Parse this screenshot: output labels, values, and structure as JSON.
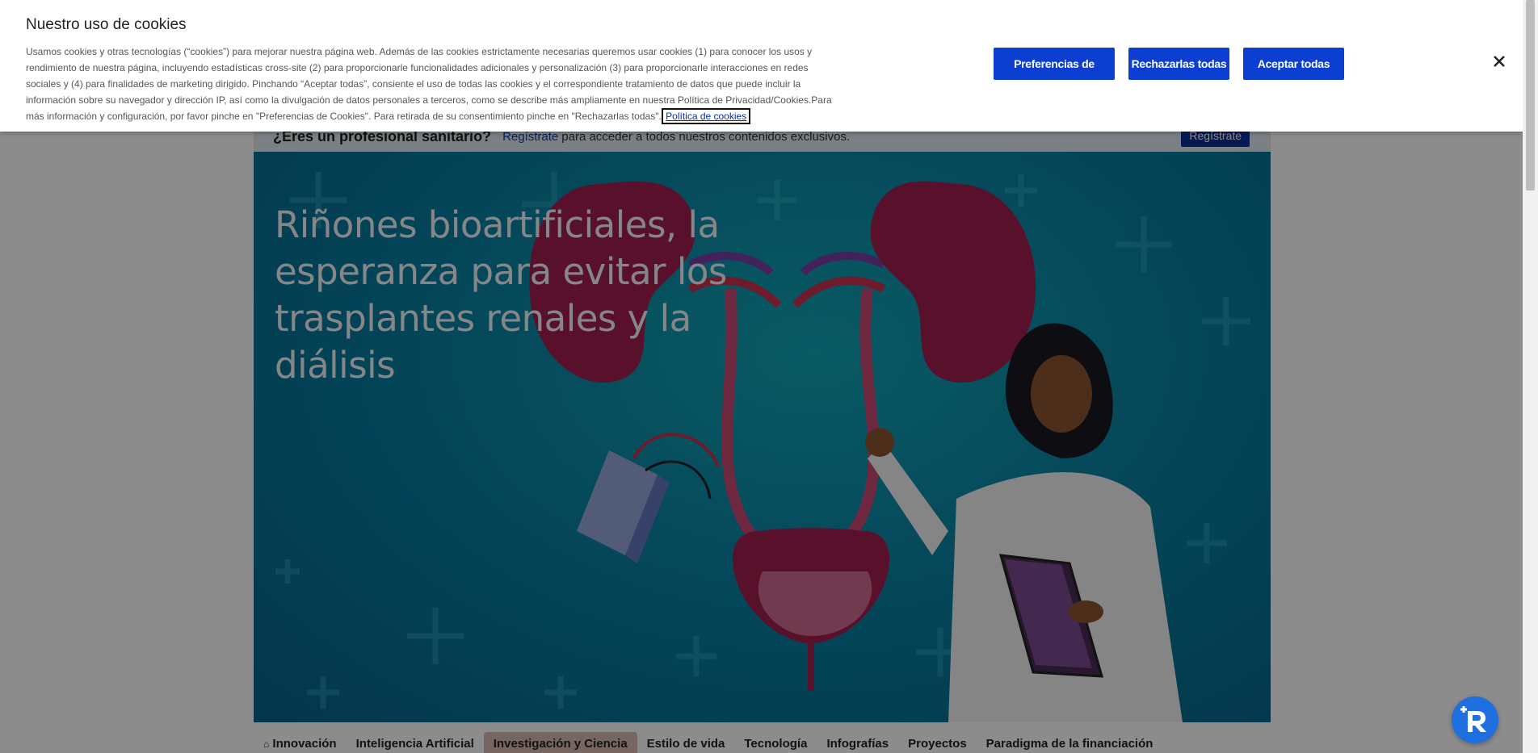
{
  "cookie_banner": {
    "title": "Nuestro uso de cookies",
    "body": "Usamos cookies y otras tecnologías (“cookies”) para mejorar nuestra página web. Además de las cookies estrictamente necesarias queremos usar cookies (1) para conocer los usos y rendimiento de nuestra página, incluyendo estadísticas cross-site (2) para proporcionarle funcionalidades adicionales y personalización (3) para proporcionarle interacciones en redes sociales y (4) para finalidades de marketing dirigido. Pinchando “Aceptar todas”, consiente el uso de todas las cookies y el correspondiente tratamiento de datos que puede incluir la información sobre su navegador y dirección IP, así como la divulgación de datos personales a terceros, como se describe más ampliamente en nuestra Política de Privacidad/Cookies.Para más información y configuración, por favor pinche en \"Preferencias de Cookies\". Para retirada de su consentimiento pinche en \"Rechazarlas todas\".",
    "policy_link": "Política de cookies",
    "prefs_button": "Preferencias de cookies",
    "reject_button": "Rechazarlas todas",
    "accept_button": "Aceptar todas",
    "close_icon": "close-icon"
  },
  "register_bar": {
    "question": "¿Eres un profesional sanitario?",
    "link": "Regístrate",
    "text": "para acceder a todos nuestros contenidos exclusivos.",
    "button": "Regístrate"
  },
  "hero": {
    "title": "Riñones bioartificiales, la esperanza para evitar los trasplantes renales y la diálisis"
  },
  "nav": {
    "items": [
      {
        "label": "Innovación",
        "icon": "home-icon"
      },
      {
        "label": "Inteligencia Artificial"
      },
      {
        "label": "Investigación y Ciencia"
      },
      {
        "label": "Estilo de vida"
      },
      {
        "label": "Tecnología"
      },
      {
        "label": "Infografías"
      },
      {
        "label": "Proyectos"
      },
      {
        "label": "Paradigma de la financiación"
      }
    ],
    "active_index": 2
  },
  "colors": {
    "button_blue": "#0b3ed1",
    "hero_teal": "#0a86a6",
    "chat_blue": "#1f6fe0"
  },
  "chat_widget": {
    "icon": "chat-assistant-icon"
  }
}
